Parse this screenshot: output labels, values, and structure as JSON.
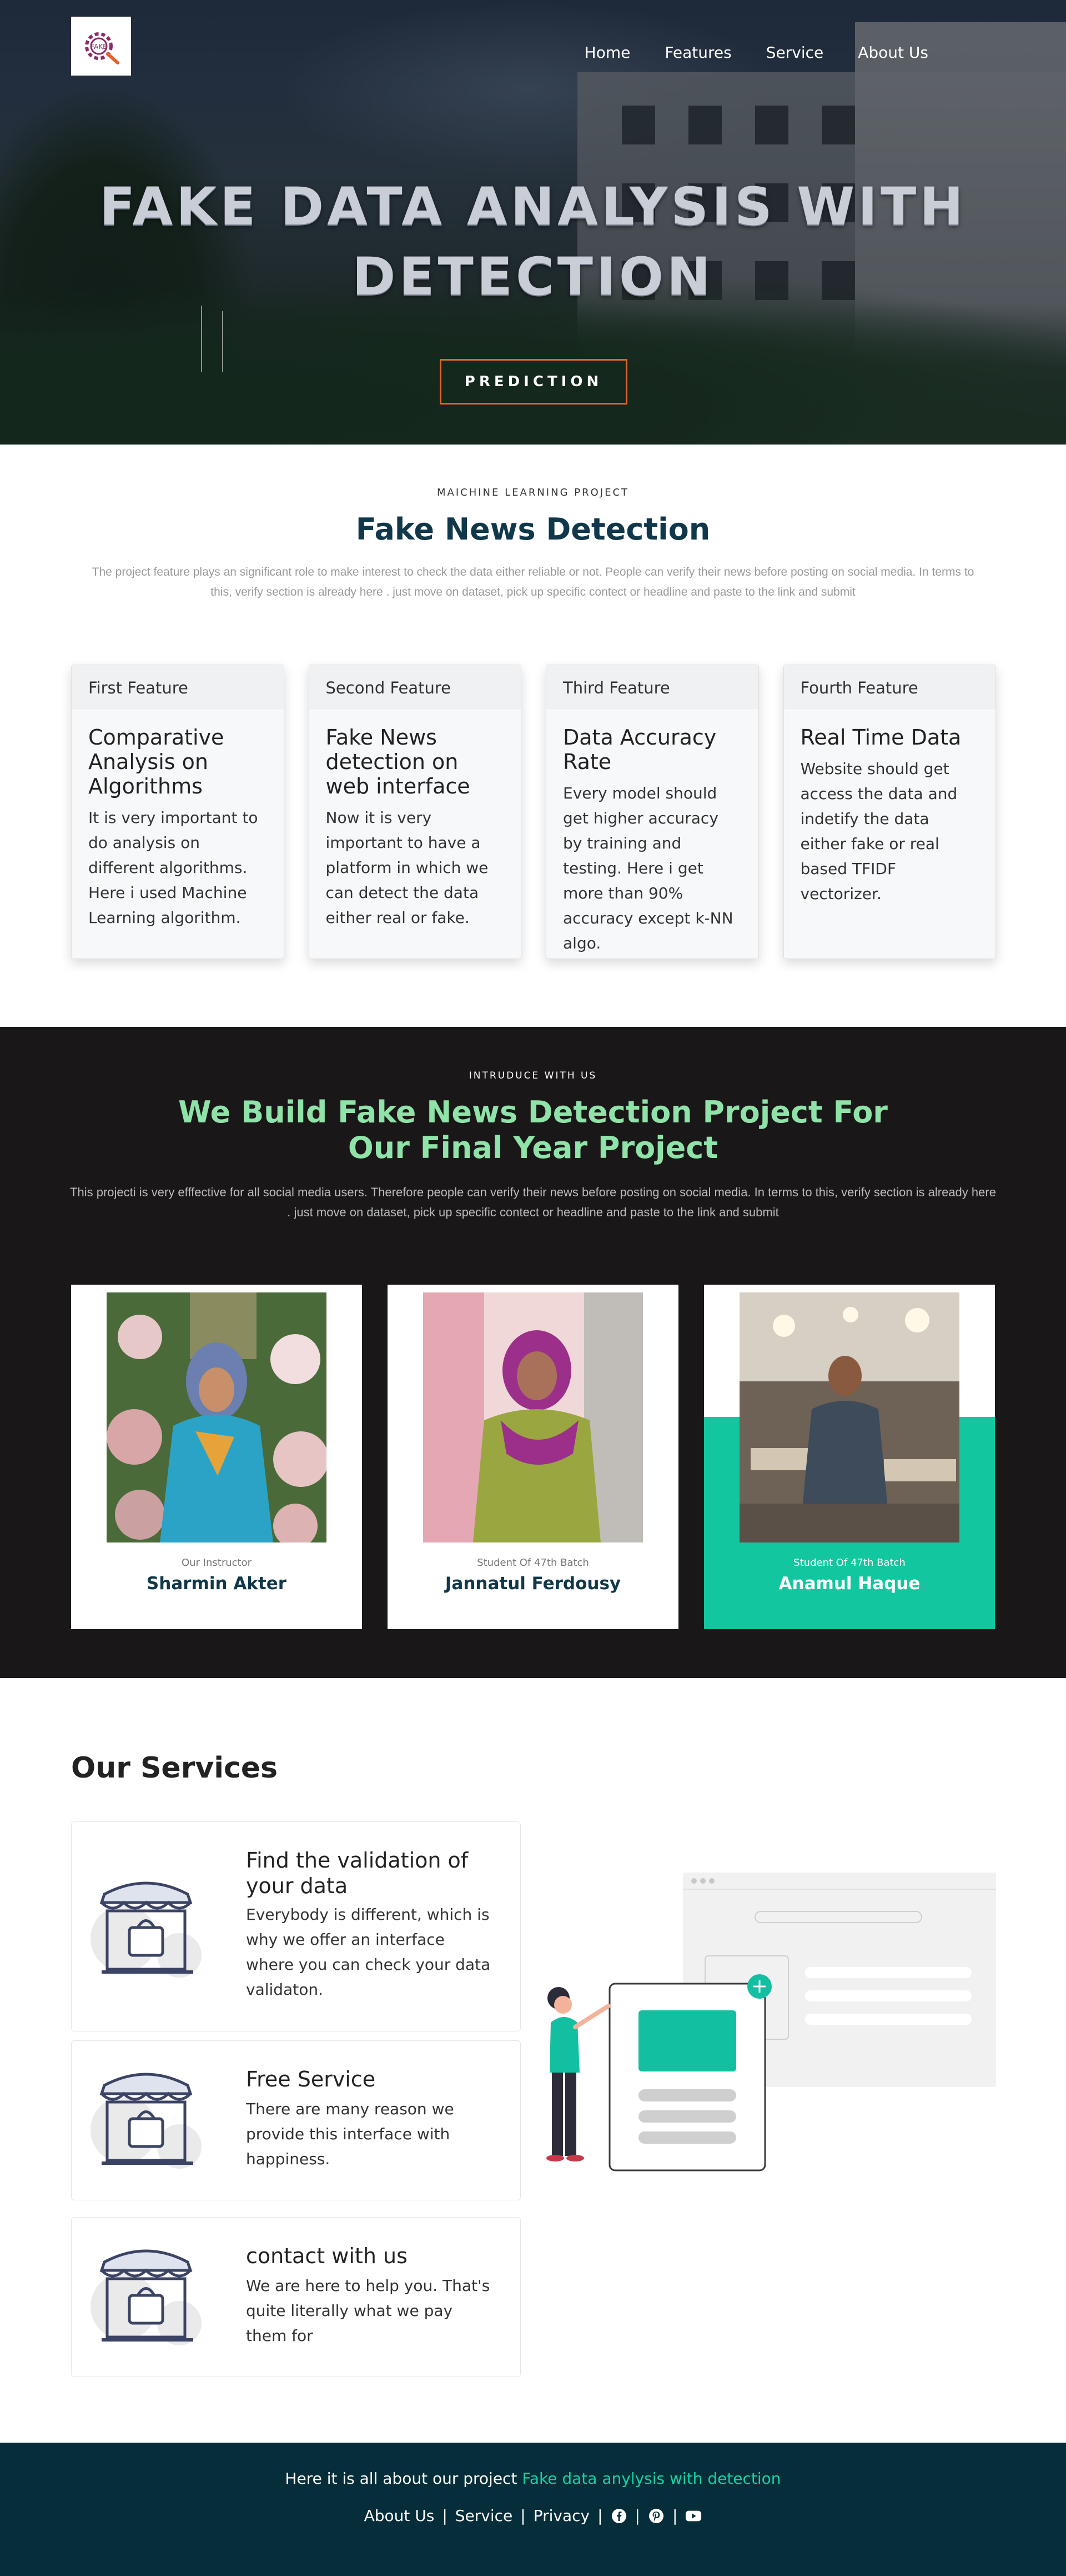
{
  "nav": {
    "logo_alt": "Fake data analysis logo",
    "items": [
      "Home",
      "Features",
      "Service",
      "About Us"
    ]
  },
  "hero": {
    "title_line1": "FAKE DATA ANALYSIS WITH",
    "title_line2": "DETECTION",
    "cta_label": "PREDICTION"
  },
  "intro": {
    "eyebrow": "MAICHINE LEARNING PROJECT",
    "title": "Fake News Detection",
    "description": "The project feature plays an significant role to make interest to check the data either reliable or not. People can verify their news before posting on social media. In terms to this, verify section is already here . just move on dataset, pick up specific contect or headline and paste to the link and submit"
  },
  "features": [
    {
      "header": "First Feature",
      "title": "Comparative Analysis on Algorithms",
      "text": "It is very important to do analysis on different algorithms. Here i used Machine Learning algorithm."
    },
    {
      "header": "Second Feature",
      "title": "Fake News detection on web interface",
      "text": "Now it is very important to have a platform in which we can detect the data either real or fake."
    },
    {
      "header": "Third Feature",
      "title": "Data Accuracy Rate",
      "text": "Every model should get higher accuracy by training and testing. Here i get more than 90% accuracy except k-NN algo."
    },
    {
      "header": "Fourth Feature",
      "title": "Real Time Data",
      "text": "Website should get access the data and indetify the data either fake or real based TFIDF vectorizer."
    }
  ],
  "team": {
    "eyebrow": "INTRUDUCE WITH US",
    "title_line1": "We Build Fake News Detection Project For",
    "title_line2": "Our Final Year Project",
    "description": "This projecti is very efffective for all social media users. Therefore people can verify their news before posting on social media. In terms to this, verify section is already here . just move on dataset, pick up specific contect or headline and paste to the link and submit",
    "members": [
      {
        "role": "Our Instructor",
        "name": "Sharmin Akter"
      },
      {
        "role": "Student Of 47th Batch",
        "name": "Jannatul Ferdousy"
      },
      {
        "role": "Student Of 47th Batch",
        "name": "Anamul Haque"
      }
    ]
  },
  "services": {
    "title": "Our Services",
    "items": [
      {
        "title": "Find the validation of your data",
        "text": "Everybody is different, which is why we offer an interface where you can check your data validaton."
      },
      {
        "title": "Free Service",
        "text": "There are many reason we provide this interface with happiness."
      },
      {
        "title": "contact with us",
        "text": "We are here to help you. That's quite literally what we pay them for"
      }
    ]
  },
  "footer": {
    "tag_prefix": "Here it is all about our project ",
    "tag_accent": "Fake data anylysis with detection",
    "links": [
      "About Us",
      "Service",
      "Privacy"
    ],
    "separator": "|"
  },
  "colors": {
    "accent_teal": "#12c79f",
    "navy": "#10384a",
    "mint_heading": "#8fe3a9",
    "cta_border": "#e2632a",
    "footer_bg": "#062d3a"
  }
}
